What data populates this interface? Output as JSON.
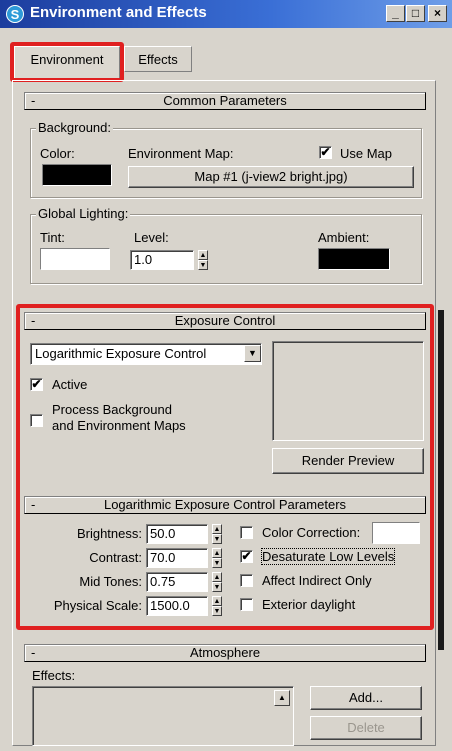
{
  "window": {
    "title": "Environment and Effects",
    "minimize": "_",
    "maximize": "□",
    "close": "×",
    "icon": "S"
  },
  "tabs": [
    {
      "label": "Environment"
    },
    {
      "label": "Effects"
    }
  ],
  "common": {
    "header": "Common Parameters",
    "minus": "-",
    "background": {
      "label": "Background:",
      "color_label": "Color:",
      "env_map_label": "Environment Map:",
      "use_map_label": "Use Map",
      "use_map_checked": "✔",
      "map_button": "Map #1 (j-view2 bright.jpg)",
      "color": "#000000"
    },
    "global_lighting": {
      "label": "Global Lighting:",
      "tint_label": "Tint:",
      "level_label": "Level:",
      "level_value": "1.0",
      "ambient_label": "Ambient:",
      "tint_color": "#ffffff",
      "ambient_color": "#000000"
    }
  },
  "exposure": {
    "header": "Exposure Control",
    "minus": "-",
    "dropdown_value": "Logarithmic Exposure Control",
    "active_label": "Active",
    "active_checked": "✔",
    "process_label_1": "Process Background",
    "process_label_2": "and Environment Maps",
    "render_preview": "Render Preview"
  },
  "log_params": {
    "header": "Logarithmic Exposure Control Parameters",
    "minus": "-",
    "brightness_label": "Brightness:",
    "brightness_value": "50.0",
    "contrast_label": "Contrast:",
    "contrast_value": "70.0",
    "midtones_label": "Mid Tones:",
    "midtones_value": "0.75",
    "physical_label": "Physical Scale:",
    "physical_value": "1500.0",
    "color_correction_label": "Color Correction:",
    "desaturate_label": "Desaturate Low Levels",
    "desaturate_checked": "✔",
    "affect_indirect_label": "Affect Indirect Only",
    "exterior_label": "Exterior daylight"
  },
  "atmosphere": {
    "header": "Atmosphere",
    "minus": "-",
    "effects_label": "Effects:",
    "add_button": "Add...",
    "delete_button": "Delete"
  },
  "colors": {
    "highlight": "#e02020",
    "title_bar": "#1c3d9e"
  }
}
